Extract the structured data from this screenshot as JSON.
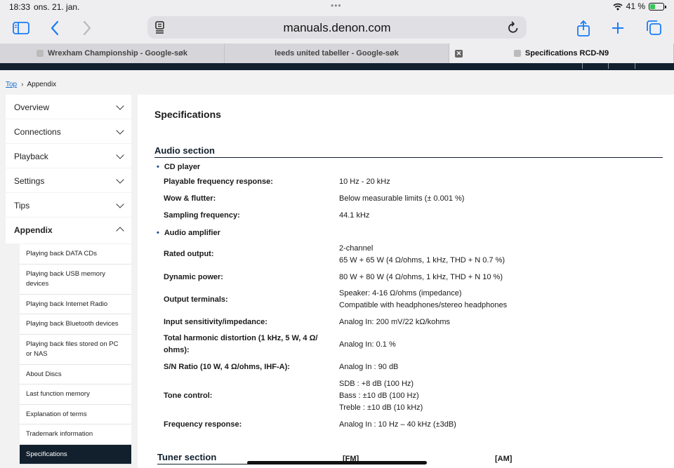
{
  "status": {
    "time": "18:33",
    "date": "ons. 21. jan.",
    "battery": "41 %",
    "battery_level": 0.41
  },
  "toolbar": {
    "url": "manuals.denon.com"
  },
  "tabs": [
    {
      "label": "Wrexham Championship - Google-søk"
    },
    {
      "label": "leeds united tabeller - Google-søk"
    },
    {
      "label": "Specifications RCD-N9"
    }
  ],
  "breadcrumb": {
    "top": "Top",
    "current": "Appendix"
  },
  "sidebar": {
    "items": [
      {
        "label": "Overview"
      },
      {
        "label": "Connections"
      },
      {
        "label": "Playback"
      },
      {
        "label": "Settings"
      },
      {
        "label": "Tips"
      },
      {
        "label": "Appendix"
      }
    ],
    "sub_items": [
      {
        "label": "Playing back DATA CDs"
      },
      {
        "label": "Playing back USB memory devices"
      },
      {
        "label": "Playing back Internet Radio"
      },
      {
        "label": "Playing back Bluetooth devices"
      },
      {
        "label": "Playing back files stored on PC or NAS"
      },
      {
        "label": "About Discs"
      },
      {
        "label": "Last function memory"
      },
      {
        "label": "Explanation of terms"
      },
      {
        "label": "Trademark information"
      },
      {
        "label": "Specifications"
      }
    ]
  },
  "main": {
    "title": "Specifications",
    "audio_section": "Audio section",
    "cd_player": "CD player",
    "audio_amplifier": "Audio amplifier",
    "specs": [
      {
        "label": "Playable frequency response:",
        "value": "10 Hz - 20 kHz"
      },
      {
        "label": "Wow & flutter:",
        "value": "Below measurable limits (± 0.001 %)"
      },
      {
        "label": "Sampling frequency:",
        "value": "44.1 kHz"
      },
      {
        "label": "Rated output:",
        "value1": "2-channel",
        "value2": "65 W + 65 W (4 Ω/ohms, 1 kHz, THD + N 0.7 %)"
      },
      {
        "label": "Dynamic power:",
        "value": "80 W + 80 W (4 Ω/ohms, 1 kHz, THD + N 10 %)"
      },
      {
        "label": "Output terminals:",
        "value1": "Speaker: 4-16 Ω/ohms (impedance)",
        "value2": "Compatible with headphones/stereo headphones"
      },
      {
        "label": "Input sensitivity/impedance:",
        "value": "Analog In: 200 mV/22 kΩ/kohms"
      },
      {
        "label1": "Total harmonic distortion (1 kHz, 5 W, 4 Ω/",
        "label2": "ohms):",
        "value": "Analog In: 0.1 %"
      },
      {
        "label": "S/N Ratio (10 W, 4 Ω/ohms, IHF-A):",
        "value": "Analog In : 90 dB"
      },
      {
        "label": "Tone control:",
        "value1": "SDB : +8 dB (100 Hz)",
        "value2": "Bass : ±10 dB (100 Hz)",
        "value3": "Treble : ±10 dB (10 kHz)"
      },
      {
        "label": "Frequency response:",
        "value": "Analog In : 10 Hz – 40 kHz (±3dB)"
      }
    ],
    "tuner_section": "Tuner section",
    "fm": "[FM]",
    "am": "[AM]"
  }
}
